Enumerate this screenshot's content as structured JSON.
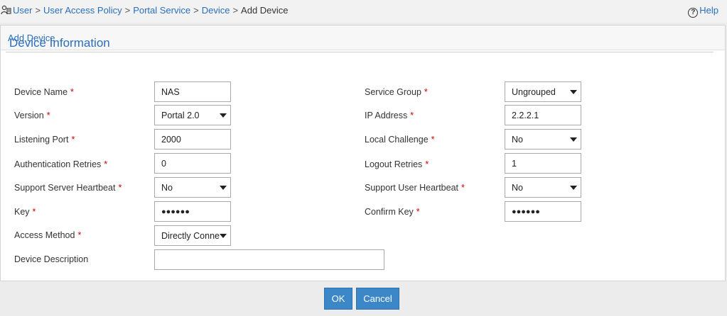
{
  "breadcrumb": {
    "items": [
      "User",
      "User Access Policy",
      "Portal Service",
      "Device"
    ],
    "current": "Add Device",
    "separator": ">"
  },
  "help": {
    "label": "Help",
    "icon": "question-circle-icon"
  },
  "panel": {
    "title": "Add Device"
  },
  "section": {
    "title": "Device Information"
  },
  "fields": {
    "device_name": {
      "label": "Device Name",
      "value": "NAS"
    },
    "version": {
      "label": "Version",
      "value": "Portal 2.0"
    },
    "listening_port": {
      "label": "Listening Port",
      "value": "2000"
    },
    "auth_retries": {
      "label": "Authentication Retries",
      "value": "0"
    },
    "server_heartbeat": {
      "label": "Support Server Heartbeat",
      "value": "No"
    },
    "key": {
      "label": "Key",
      "value": "●●●●●●"
    },
    "access_method": {
      "label": "Access Method",
      "value": "Directly Connected"
    },
    "device_description": {
      "label": "Device Description",
      "value": ""
    },
    "service_group": {
      "label": "Service Group",
      "value": "Ungrouped"
    },
    "ip_address": {
      "label": "IP Address",
      "value": "2.2.2.1"
    },
    "local_challenge": {
      "label": "Local Challenge",
      "value": "No"
    },
    "logout_retries": {
      "label": "Logout Retries",
      "value": "1"
    },
    "user_heartbeat": {
      "label": "Support User Heartbeat",
      "value": "No"
    },
    "confirm_key": {
      "label": "Confirm Key",
      "value": "●●●●●●"
    }
  },
  "required_mark": "*",
  "buttons": {
    "ok": "OK",
    "cancel": "Cancel"
  },
  "colors": {
    "link": "#2a6ebb",
    "required": "#cc0000",
    "button": "#3c87c8"
  }
}
